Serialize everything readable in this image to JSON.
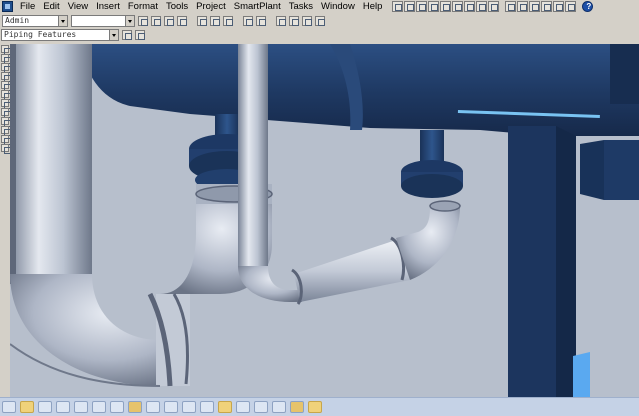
{
  "menu": {
    "items": [
      "File",
      "Edit",
      "View",
      "Insert",
      "Format",
      "Tools",
      "Project",
      "SmartPlant",
      "Tasks",
      "Window",
      "Help"
    ]
  },
  "toolbar": {
    "user_combo_value": "Admin",
    "second_combo_value": "",
    "features_combo_value": "Piping Features",
    "help_glyph": "?"
  },
  "icons": {
    "app": "smartplant-app-icon",
    "help": "help-icon"
  },
  "colors": {
    "viewport_bg": "#b7bfcc",
    "vessel": "#1f3a64",
    "flange": "#213f6d",
    "pipe": "#c9d0dc",
    "structure": "#1c355e",
    "highlight": "#79c3f2"
  }
}
